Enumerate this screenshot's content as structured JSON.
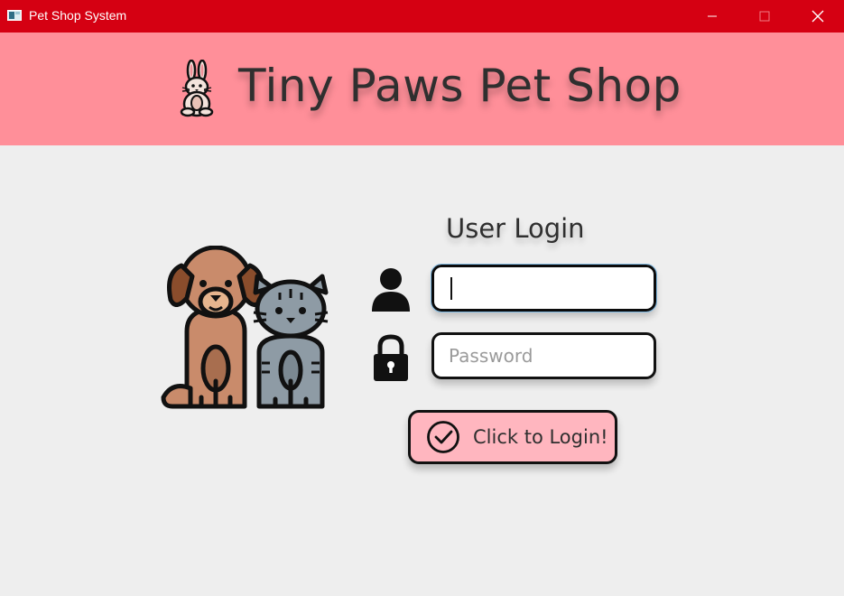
{
  "window": {
    "title": "Pet Shop System",
    "icon": "window-app-icon",
    "titlebar_color": "#D50012"
  },
  "banner": {
    "title": "Tiny Paws Pet Shop",
    "icon": "bunny-icon",
    "background": "#FF8F99"
  },
  "illustration": {
    "icon": "dog-and-cat-icon"
  },
  "login": {
    "heading": "User Login",
    "username": {
      "icon": "user-icon",
      "value": "",
      "placeholder": ""
    },
    "password": {
      "icon": "lock-icon",
      "value": "",
      "placeholder": "Password"
    },
    "button": {
      "label": "Click to Login!",
      "icon": "check-circle-icon",
      "background": "#FFB6BF"
    }
  },
  "background": "#EEEEEE"
}
